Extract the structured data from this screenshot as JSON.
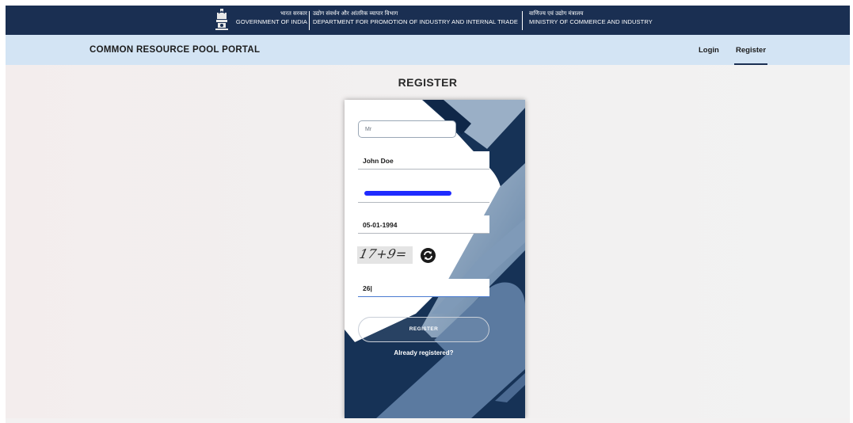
{
  "gov_banner": {
    "hindi_gov": "भारत सरकार",
    "english_gov": "GOVERNMENT OF INDIA",
    "hindi_dept": "उद्योग संवर्धन और आंतरिक व्यापार विभाग",
    "english_dept": "DEPARTMENT FOR PROMOTION OF INDUSTRY AND INTERNAL TRADE",
    "hindi_ministry": "वाणिज्य एवं उद्योग मंत्रालय",
    "english_ministry": "MINISTRY OF COMMERCE AND INDUSTRY"
  },
  "nav": {
    "portal_title": "COMMON RESOURCE POOL PORTAL",
    "login": "Login",
    "register": "Register"
  },
  "page": {
    "heading": "REGISTER"
  },
  "form": {
    "title_value": "Mr",
    "name_value": "John Doe",
    "dob_value": "05-01-1994",
    "captcha_text": "17+9=",
    "answer_value": "26|",
    "submit_label": "REGISTER",
    "already_registered": "Already registered?"
  },
  "colors": {
    "banner": "#1a2f52",
    "nav_bar": "#d3e4f4",
    "card_dark": "#163256",
    "card_light": "#9aafc6"
  },
  "icons": {
    "emblem": "national-emblem-icon",
    "refresh": "refresh-icon"
  }
}
